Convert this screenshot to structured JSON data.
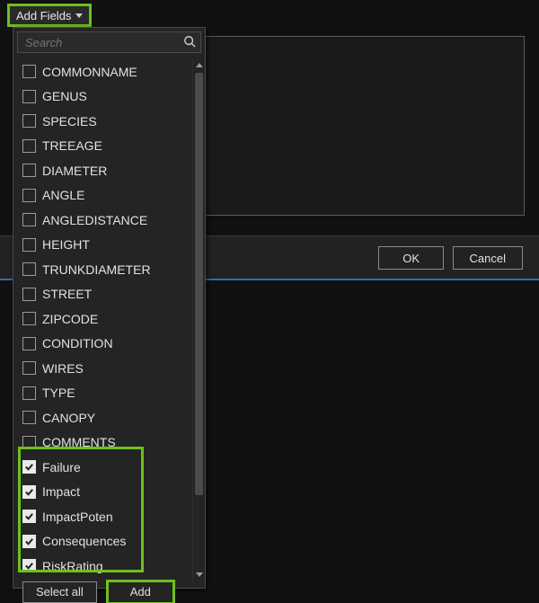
{
  "trigger": {
    "label": "Add Fields"
  },
  "search": {
    "placeholder": "Search"
  },
  "fields": [
    {
      "label": "COMMONNAME",
      "checked": false
    },
    {
      "label": "GENUS",
      "checked": false
    },
    {
      "label": "SPECIES",
      "checked": false
    },
    {
      "label": "TREEAGE",
      "checked": false
    },
    {
      "label": "DIAMETER",
      "checked": false
    },
    {
      "label": "ANGLE",
      "checked": false
    },
    {
      "label": "ANGLEDISTANCE",
      "checked": false
    },
    {
      "label": "HEIGHT",
      "checked": false
    },
    {
      "label": "TRUNKDIAMETER",
      "checked": false
    },
    {
      "label": "STREET",
      "checked": false
    },
    {
      "label": "ZIPCODE",
      "checked": false
    },
    {
      "label": "CONDITION",
      "checked": false
    },
    {
      "label": "WIRES",
      "checked": false
    },
    {
      "label": "TYPE",
      "checked": false
    },
    {
      "label": "CANOPY",
      "checked": false
    },
    {
      "label": "COMMENTS",
      "checked": false
    },
    {
      "label": "Failure",
      "checked": true
    },
    {
      "label": "Impact",
      "checked": true
    },
    {
      "label": "ImpactPoten",
      "checked": true
    },
    {
      "label": "Consequences",
      "checked": true
    },
    {
      "label": "RiskRating",
      "checked": true
    }
  ],
  "footer": {
    "select_all": "Select all",
    "add": "Add"
  },
  "dialog": {
    "ok": "OK",
    "cancel": "Cancel"
  }
}
